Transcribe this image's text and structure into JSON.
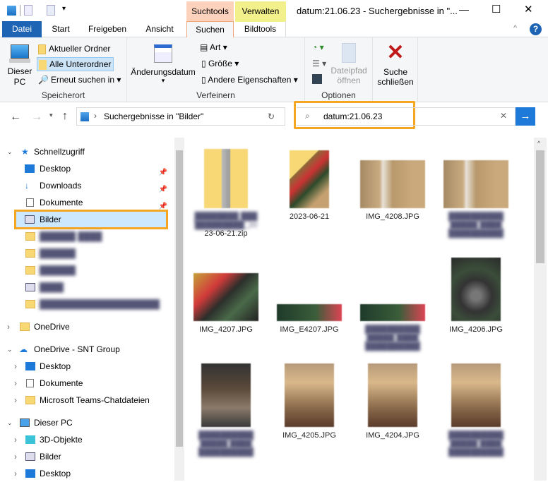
{
  "window": {
    "title": "datum:21.06.23 - Suchergebnisse in \"...",
    "minimize": "—",
    "maximize": "☐",
    "close": "✕"
  },
  "context_tabs": {
    "suchtools": "Suchtools",
    "verwalten": "Verwalten",
    "colors": {
      "suchtools": "#fcd2bd",
      "verwalten": "#f2f08a"
    }
  },
  "tabs": [
    "Datei",
    "Start",
    "Freigeben",
    "Ansicht",
    "Suchen",
    "Bildtools"
  ],
  "ribbon": {
    "speicherort": {
      "label": "Speicherort",
      "dieser_pc": "Dieser PC",
      "aktueller_ordner": "Aktueller Ordner",
      "alle_unterordner": "Alle Unterordner",
      "erneut": "Erneut suchen in"
    },
    "verfeinern": {
      "label": "Verfeinern",
      "aenderungsdatum": "Änderungsdatum",
      "art": "Art",
      "groesse": "Größe",
      "andere": "Andere Eigenschaften"
    },
    "optionen": {
      "label": "Optionen",
      "dateipfad": "Dateipfad öffnen"
    },
    "suche_schliessen": "Suche schließen"
  },
  "nav": {
    "address": "Suchergebnisse in \"Bilder\"",
    "search": "datum:21.06.23",
    "highlight_color": "#f5a623"
  },
  "sidebar": {
    "schnellzugriff": "Schnellzugriff",
    "quick": [
      "Desktop",
      "Downloads",
      "Dokumente",
      "Bilder"
    ],
    "onedrive": "OneDrive",
    "onedrive_snt": "OneDrive - SNT Group",
    "snt_items": [
      "Desktop",
      "Dokumente",
      "Microsoft Teams-Chatdateien"
    ],
    "dieser_pc": "Dieser PC",
    "pc_items": [
      "3D-Objekte",
      "Bilder",
      "Desktop"
    ]
  },
  "files": [
    {
      "name": "23-06-21.zip",
      "type": "zip"
    },
    {
      "name": "2023-06-21",
      "type": "folder"
    },
    {
      "name": "IMG_4208.JPG",
      "type": "boxes"
    },
    {
      "name": "",
      "type": "boxes"
    },
    {
      "name": "IMG_4207.JPG",
      "type": "cable"
    },
    {
      "name": "IMG_E4207.JPG",
      "type": "board"
    },
    {
      "name": "",
      "type": "board"
    },
    {
      "name": "IMG_4206.JPG",
      "type": "fan"
    },
    {
      "name": "",
      "type": "pc"
    },
    {
      "name": "IMG_4205.JPG",
      "type": "bench"
    },
    {
      "name": "IMG_4204.JPG",
      "type": "bench"
    },
    {
      "name": "",
      "type": "bench"
    }
  ]
}
